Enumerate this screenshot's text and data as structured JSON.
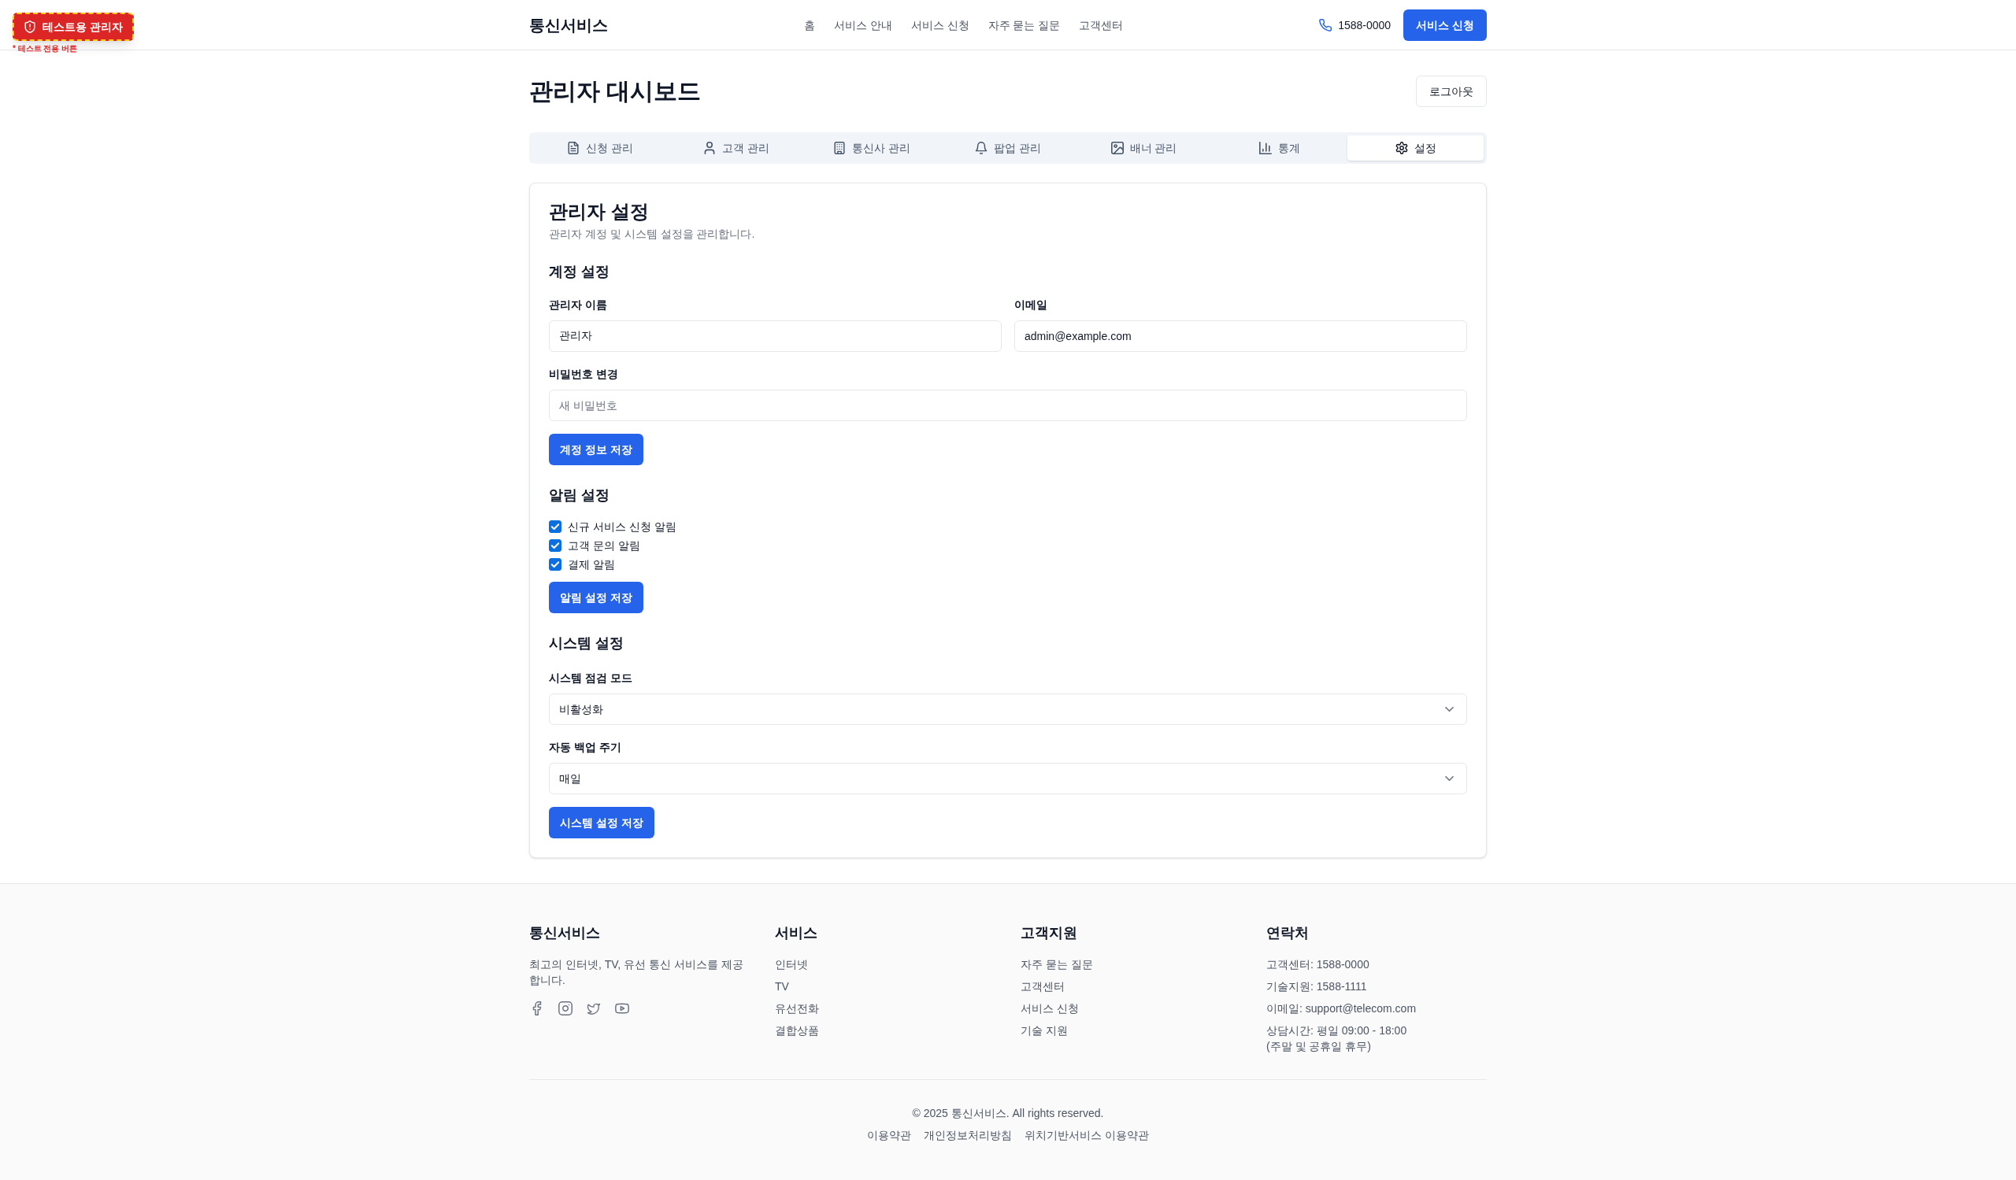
{
  "test_badge": {
    "label": "테스트용 관리자",
    "note": "* 테스트 전용 버튼"
  },
  "header": {
    "brand": "통신서비스",
    "nav": [
      "홈",
      "서비스 안내",
      "서비스 신청",
      "자주 묻는 질문",
      "고객센터"
    ],
    "phone": "1588-0000",
    "cta_button": "서비스 신청"
  },
  "dashboard": {
    "title": "관리자 대시보드",
    "logout_button": "로그아웃"
  },
  "tabs": [
    {
      "label": "신청 관리",
      "selected": false
    },
    {
      "label": "고객 관리",
      "selected": false
    },
    {
      "label": "통신사 관리",
      "selected": false
    },
    {
      "label": "팝업 관리",
      "selected": false
    },
    {
      "label": "배너 관리",
      "selected": false
    },
    {
      "label": "통계",
      "selected": false
    },
    {
      "label": "설정",
      "selected": true
    }
  ],
  "settings": {
    "title": "관리자 설정",
    "description": "관리자 계정 및 시스템 설정을 관리합니다.",
    "account": {
      "heading": "계정 설정",
      "fields": [
        {
          "label": "관리자 이름",
          "value": "관리자"
        },
        {
          "label": "이메일",
          "value": "admin@example.com"
        }
      ],
      "password": {
        "label": "비밀번호 변경",
        "placeholder": "새 비밀번호"
      },
      "save_button": "계정 정보 저장"
    },
    "notifications": {
      "heading": "알림 설정",
      "options": [
        {
          "label": "신규 서비스 신청 알림",
          "checked": true
        },
        {
          "label": "고객 문의 알림",
          "checked": true
        },
        {
          "label": "결제 알림",
          "checked": true
        }
      ],
      "save_button": "알림 설정 저장"
    },
    "system": {
      "heading": "시스템 설정",
      "selects": [
        {
          "label": "시스템 점검 모드",
          "value": "비활성화"
        },
        {
          "label": "자동 백업 주기",
          "value": "매일"
        }
      ],
      "save_button": "시스템 설정 저장"
    }
  },
  "footer": {
    "columns": [
      {
        "kind": "about",
        "heading": "통신서비스",
        "text": "최고의 인터넷, TV, 유선 통신 서비스를 제공합니다."
      },
      {
        "kind": "links",
        "heading": "서비스",
        "items": [
          "인터넷",
          "TV",
          "유선전화",
          "결합상품"
        ]
      },
      {
        "kind": "links",
        "heading": "고객지원",
        "items": [
          "자주 묻는 질문",
          "고객센터",
          "서비스 신청",
          "기술 지원"
        ]
      },
      {
        "kind": "contact",
        "heading": "연락처",
        "items": [
          "고객센터: 1588-0000",
          "기술지원: 1588-1111",
          "이메일: support@telecom.com",
          "상담시간: 평일 09:00 - 18:00\n(주말 및 공휴일 휴무)"
        ]
      }
    ],
    "copyright": "© 2025 통신서비스. All rights reserved.",
    "legal_links": [
      "이용약관",
      "개인정보처리방침",
      "위치기반서비스 이용약관"
    ]
  }
}
